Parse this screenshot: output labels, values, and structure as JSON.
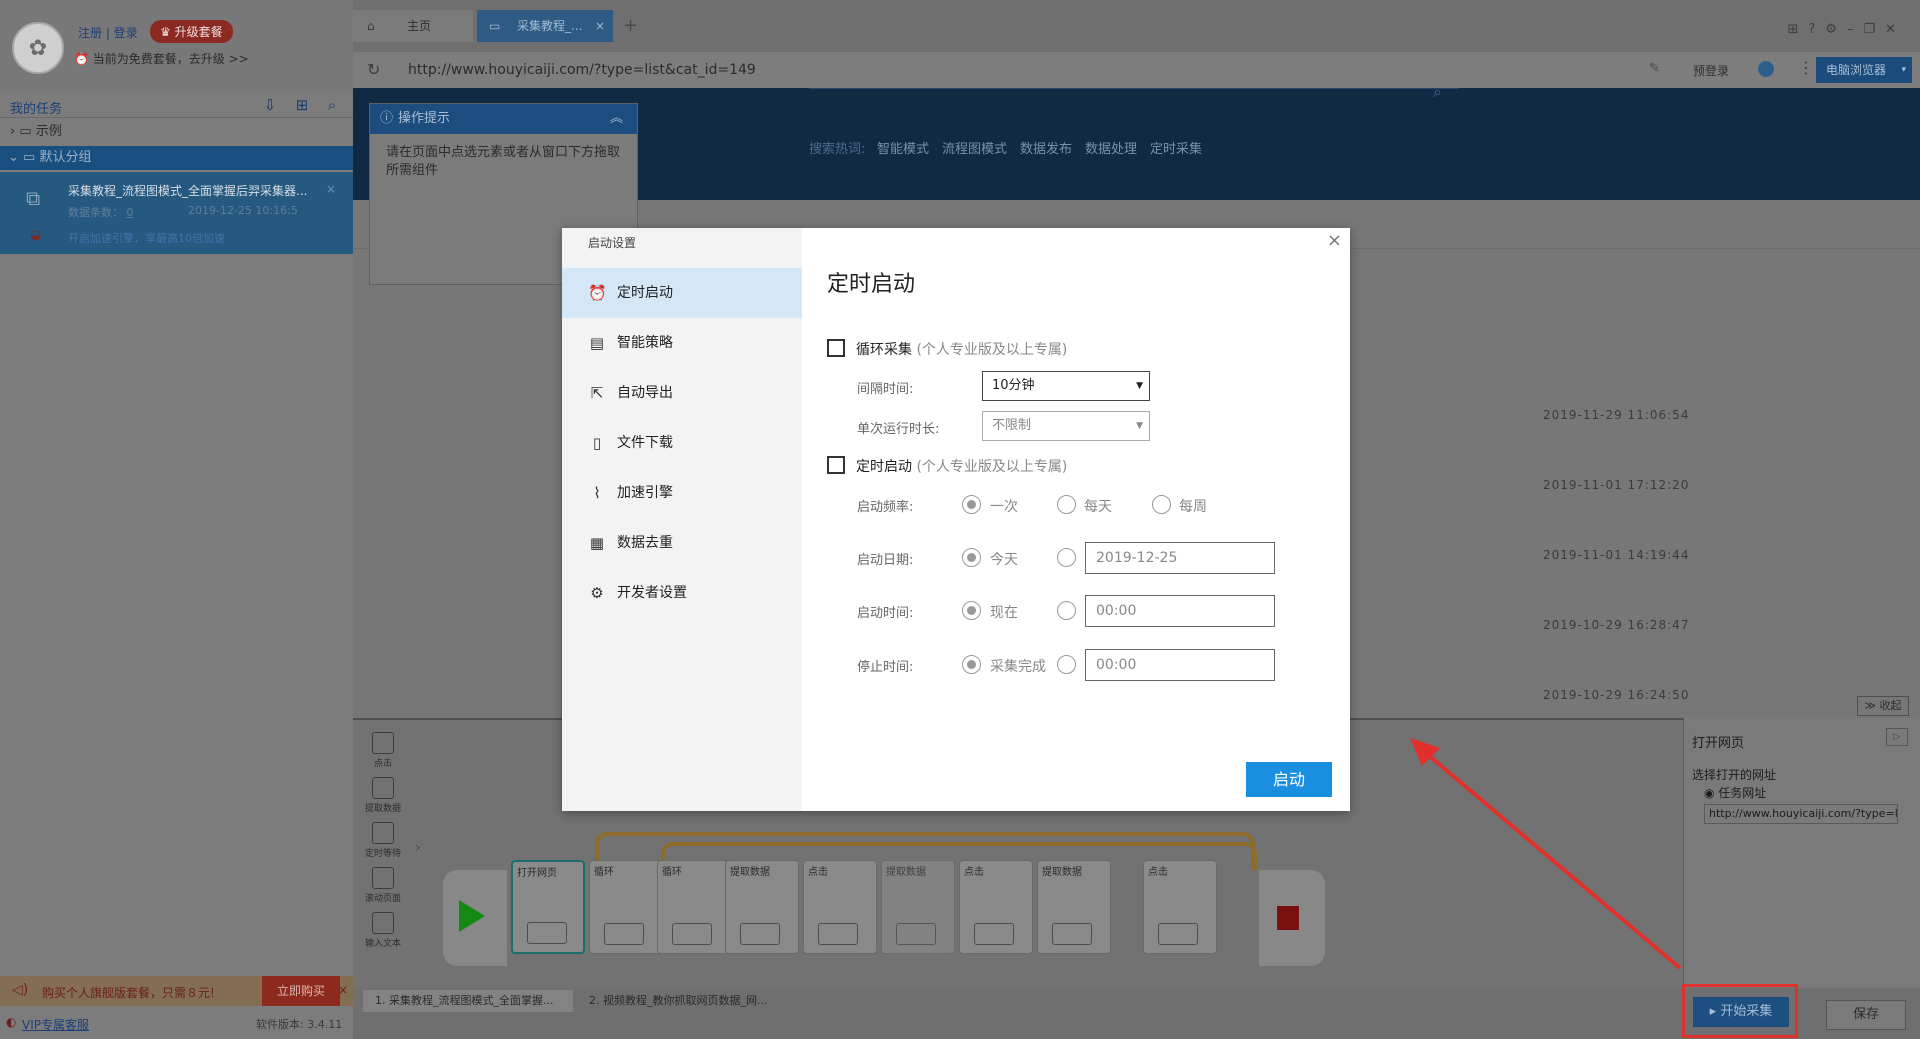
{
  "sidebar": {
    "auth_links": "注册 | 登录",
    "upgrade": "升级套餐",
    "plan_note": "当前为免费套餐，去升级 >>",
    "tasks_title": "我的任务",
    "tree": {
      "example": "示例",
      "default_group": "默认分组"
    },
    "task": {
      "name": "采集教程_流程图模式_全面掌握后羿采集器...",
      "count_label": "数据条数：",
      "count": "0",
      "date": "2019-12-25 10:16:5",
      "accel": "开启加速引擎，享最高10倍加速"
    },
    "buy_text": "购买个人旗舰版套餐，只需８元!",
    "buy_btn": "立即购买",
    "vip": "VIP专属客服",
    "version": "软件版本: 3.4.11"
  },
  "browser": {
    "tab_home": "主页",
    "tab_active": "采集教程_...",
    "url": "http://www.houyicaiji.com/?type=list&cat_id=149",
    "prelogin": "预登录",
    "browser_btn": "电脑浏览器"
  },
  "web": {
    "hot_label": "搜索热词:",
    "hot_words": [
      "智能模式",
      "流程图模式",
      "数据发布",
      "数据处理",
      "定时采集"
    ],
    "dates": [
      "2019-11-29 11:06:54",
      "2019-11-01 17:12:20",
      "2019-11-01 14:19:44",
      "2019-10-29 16:28:47",
      "2019-10-29 16:24:50"
    ],
    "collapse": "收起"
  },
  "hint": {
    "title": "操作提示",
    "body": "请在页面中点选元素或者从窗口下方拖取所需组件"
  },
  "flow": {
    "tools": [
      "点击",
      "提取数据",
      "定时等待",
      "滚动页面",
      "输入文本"
    ],
    "nodes": [
      "打开网页",
      "循环",
      "循环",
      "提取数据",
      "点击",
      "提取数据",
      "点击",
      "提取数据",
      "点击"
    ],
    "tabs": [
      "1. 采集教程_流程图模式_全面掌握...",
      "2. 视频教程_教你抓取网页数据_网..."
    ]
  },
  "right_panel": {
    "title": "打开网页",
    "select_label": "选择打开的网址",
    "radio": "任务网址",
    "url": "http://www.houyicaiji.com/?type=li",
    "start": "开始采集",
    "save": "保存"
  },
  "modal": {
    "header": "启动设置",
    "title": "定时启动",
    "nav": [
      {
        "label": "定时启动",
        "icon": "clock-icon"
      },
      {
        "label": "智能策略",
        "icon": "strategy-icon"
      },
      {
        "label": "自动导出",
        "icon": "export-icon"
      },
      {
        "label": "文件下载",
        "icon": "file-download-icon"
      },
      {
        "label": "加速引擎",
        "icon": "chart-icon"
      },
      {
        "label": "数据去重",
        "icon": "dedupe-icon"
      },
      {
        "label": "开发者设置",
        "icon": "gear-icon"
      }
    ],
    "loop": {
      "label": "循环采集",
      "note": "(个人专业版及以上专属)",
      "interval_label": "间隔时间:",
      "interval_value": "10分钟",
      "duration_label": "单次运行时长:",
      "duration_value": "不限制"
    },
    "timed": {
      "label": "定时启动",
      "note": "(个人专业版及以上专属)",
      "freq_label": "启动频率:",
      "freq_options": [
        "一次",
        "每天",
        "每周"
      ],
      "date_label": "启动日期:",
      "date_today": "今天",
      "date_value": "2019-12-25",
      "time_label": "启动时间:",
      "time_now": "现在",
      "time_value": "00:00",
      "stop_label": "停止时间:",
      "stop_done": "采集完成",
      "stop_value": "00:00"
    },
    "launch": "启动"
  }
}
